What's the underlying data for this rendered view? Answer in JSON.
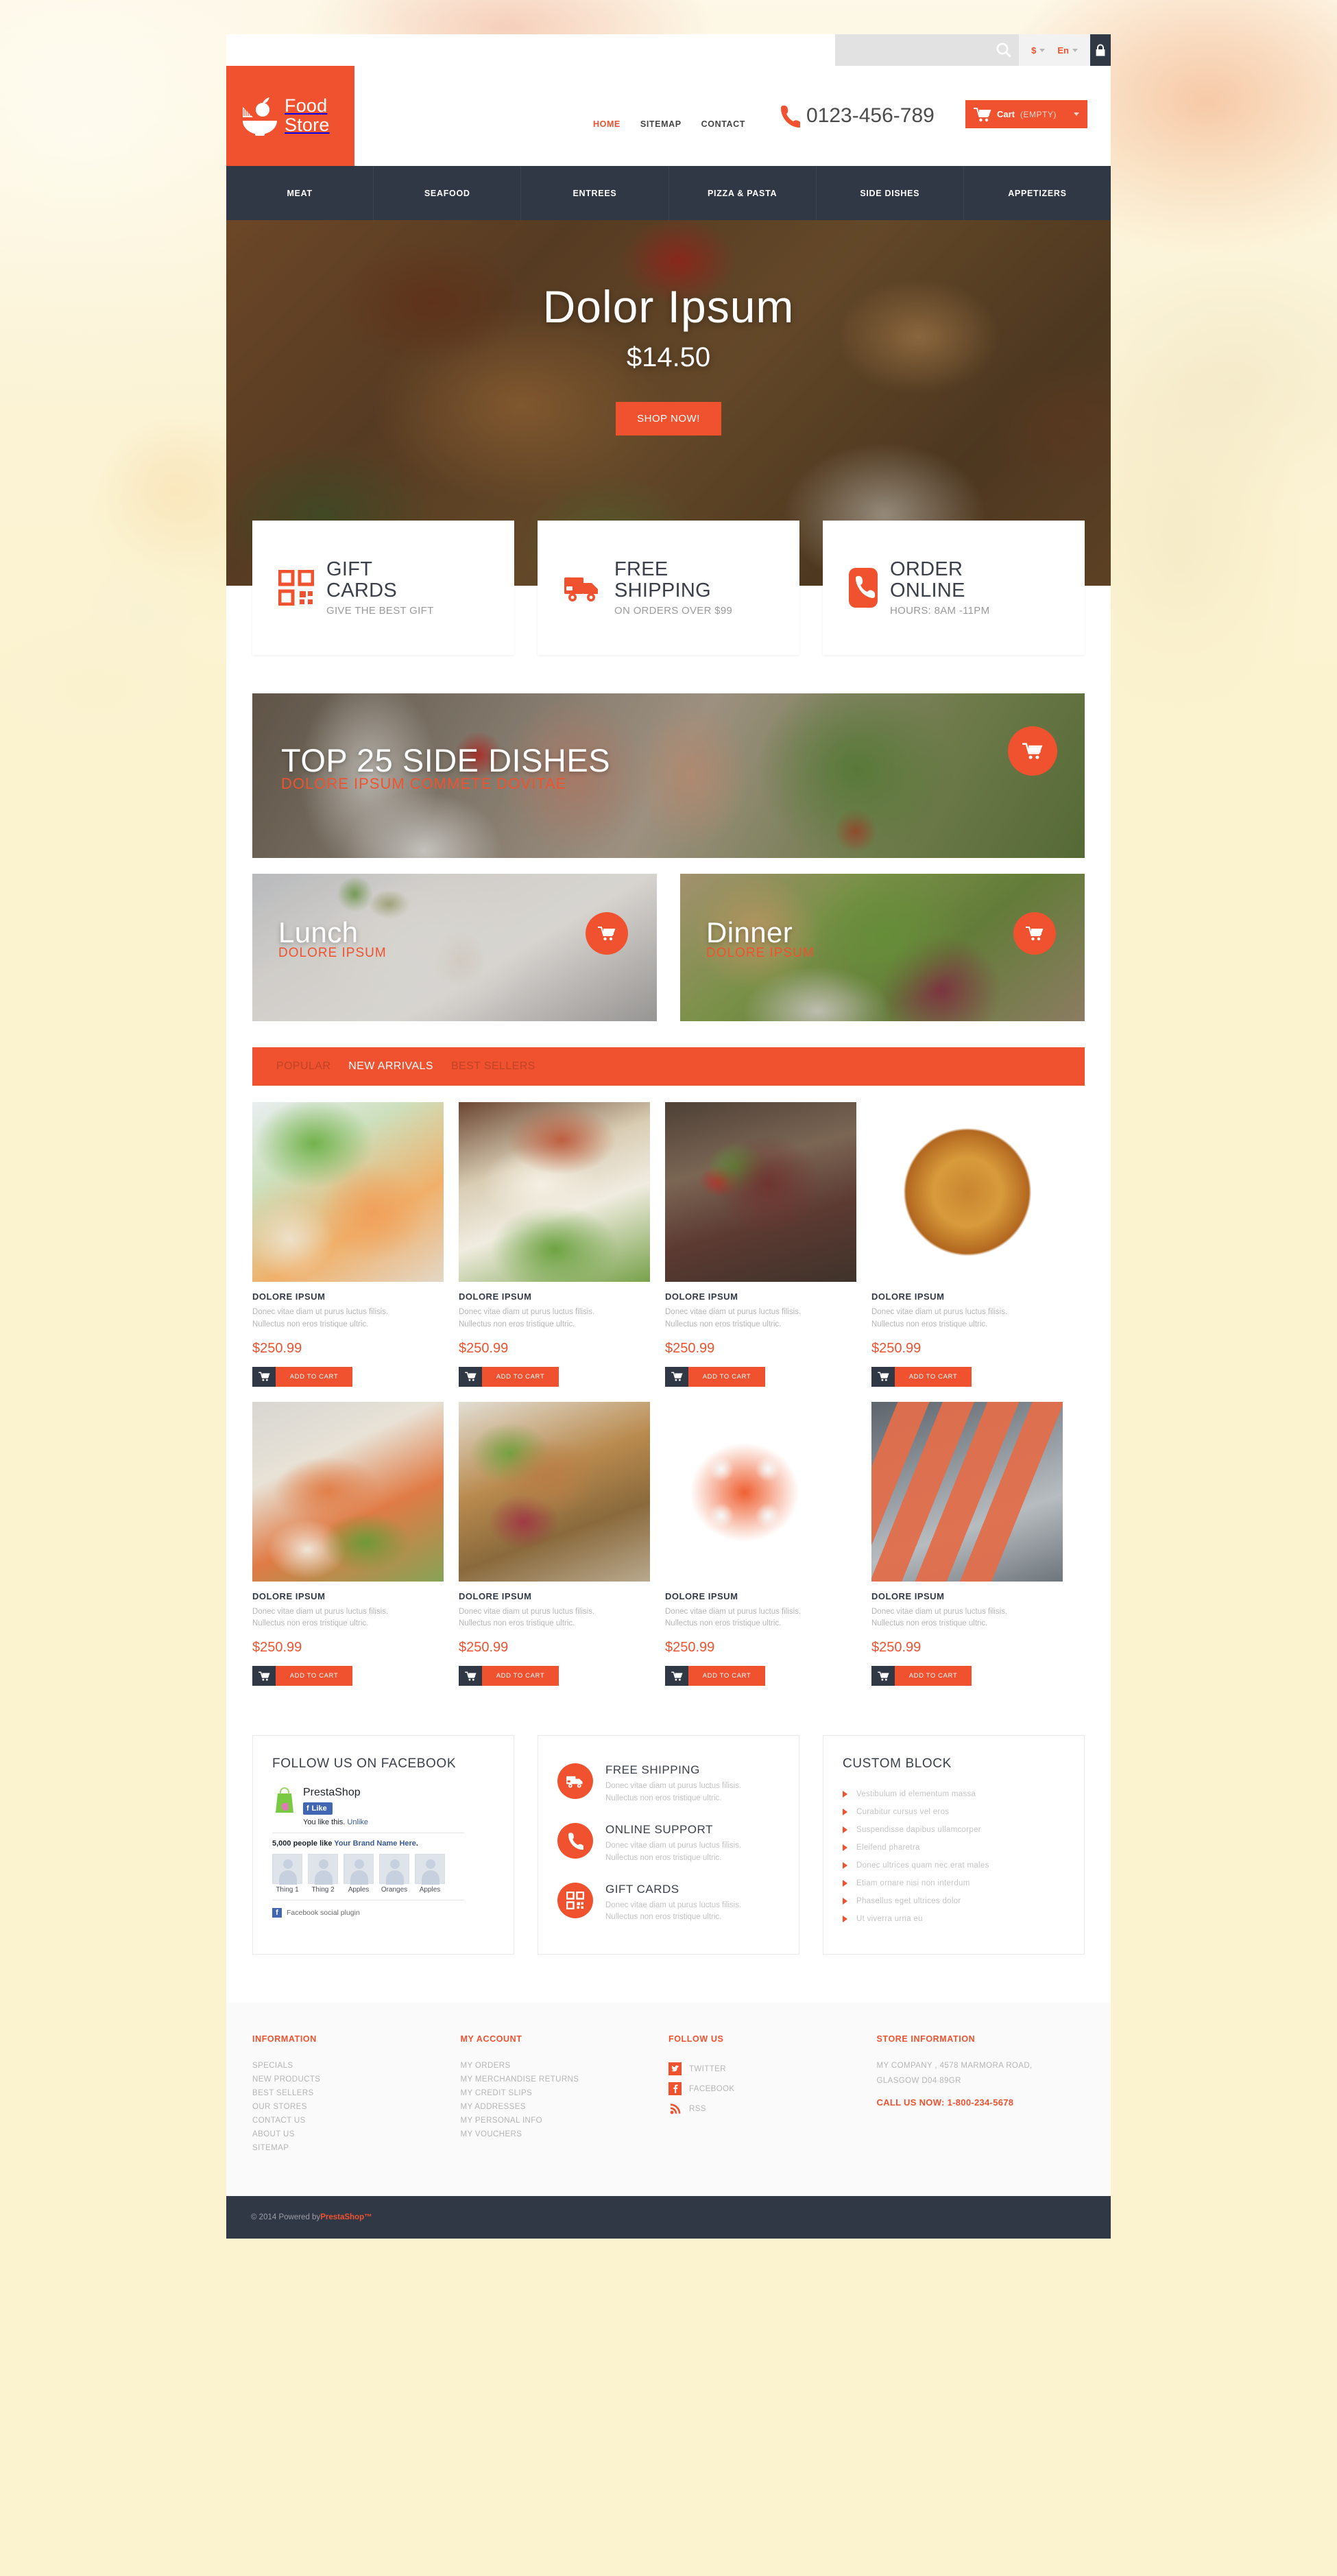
{
  "utility": {
    "search_placeholder": "",
    "search_value": "",
    "currency": "$",
    "language": "En"
  },
  "header": {
    "logo_line1": "Food",
    "logo_line2": "Store",
    "nav": [
      {
        "label": "HOME",
        "active": true
      },
      {
        "label": "SITEMAP",
        "active": false
      },
      {
        "label": "CONTACT",
        "active": false
      }
    ],
    "phone": "0123-456-789",
    "cart_label": "Cart",
    "cart_status": "(EMPTY)"
  },
  "mainnav": [
    "MEAT",
    "SEAFOOD",
    "ENTREES",
    "PIZZA & PASTA",
    "SIDE DISHES",
    "APPETIZERS"
  ],
  "hero": {
    "title": "Dolor Ipsum",
    "price": "$14.50",
    "cta": "SHOP NOW!",
    "slide_count": 3,
    "active_slide": 1
  },
  "features": [
    {
      "icon": "gift-card-icon",
      "title_line1": "GIFT",
      "title_line2": "CARDS",
      "subtitle": "GIVE THE BEST GIFT"
    },
    {
      "icon": "truck-icon",
      "title_line1": "FREE",
      "title_line2": "SHIPPING",
      "subtitle": "ON ORDERS OVER $99"
    },
    {
      "icon": "phone-icon",
      "title_line1": "ORDER",
      "title_line2": "ONLINE",
      "subtitle": "HOURS: 8AM -11PM"
    }
  ],
  "banners": {
    "wide": {
      "title": "TOP 25 SIDE DISHES",
      "subtitle": "DOLORE IPSUM COMMETE DOVITAE"
    },
    "half": [
      {
        "title": "Lunch",
        "subtitle": "DOLORE IPSUM"
      },
      {
        "title": "Dinner",
        "subtitle": "DOLORE IPSUM"
      }
    ]
  },
  "tabs": [
    {
      "label": "POPULAR",
      "active": false
    },
    {
      "label": "NEW ARRIVALS",
      "active": true
    },
    {
      "label": "BEST SELLERS",
      "active": false
    }
  ],
  "product_defaults": {
    "name": "DOLORE IPSUM",
    "desc_line1": "Donec vitae diam ut purus luctus filisis.",
    "desc_line2": "Nullectus non eros tristique ultric.",
    "price": "$250.99",
    "add_label": "ADD TO CART"
  },
  "products": [
    {
      "name": "DOLORE IPSUM",
      "desc_line1": "Donec vitae diam ut purus luctus filisis.",
      "desc_line2": "Nullectus non eros tristique ultric.",
      "price": "$250.99",
      "add_label": "ADD TO CART",
      "img": "salad-with-melon"
    },
    {
      "name": "DOLORE IPSUM",
      "desc_line1": "Donec vitae diam ut purus luctus filisis.",
      "desc_line2": "Nullectus non eros tristique ultric.",
      "price": "$250.99",
      "add_label": "ADD TO CART",
      "img": "fish-fillet-salad"
    },
    {
      "name": "DOLORE IPSUM",
      "desc_line1": "Donec vitae diam ut purus luctus filisis.",
      "desc_line2": "Nullectus non eros tristique ultric.",
      "price": "$250.99",
      "add_label": "ADD TO CART",
      "img": "grilled-steak"
    },
    {
      "name": "DOLORE IPSUM",
      "desc_line1": "Donec vitae diam ut purus luctus filisis.",
      "desc_line2": "Nullectus non eros tristique ultric.",
      "price": "$250.99",
      "add_label": "ADD TO CART",
      "img": "pizza"
    },
    {
      "name": "DOLORE IPSUM",
      "desc_line1": "Donec vitae diam ut purus luctus filisis.",
      "desc_line2": "Nullectus non eros tristique ultric.",
      "price": "$250.99",
      "add_label": "ADD TO CART",
      "img": "salmon-with-beans"
    },
    {
      "name": "DOLORE IPSUM",
      "desc_line1": "Donec vitae diam ut purus luctus filisis.",
      "desc_line2": "Nullectus non eros tristique ultric.",
      "price": "$250.99",
      "add_label": "ADD TO CART",
      "img": "roasted-meat-plate"
    },
    {
      "name": "DOLORE IPSUM",
      "desc_line1": "Donec vitae diam ut purus luctus filisis.",
      "desc_line2": "Nullectus non eros tristique ultric.",
      "price": "$250.99",
      "add_label": "ADD TO CART",
      "img": "sushi-rolls"
    },
    {
      "name": "DOLORE IPSUM",
      "desc_line1": "Donec vitae diam ut purus luctus filisis.",
      "desc_line2": "Nullectus non eros tristique ultric.",
      "price": "$250.99",
      "add_label": "ADD TO CART",
      "img": "salmon-slices"
    }
  ],
  "facebook_block": {
    "title": "FOLLOW US ON FACEBOOK",
    "page_name": "PrestaShop",
    "like_label": "Like",
    "you_like": "You like this.",
    "unlike": "Unlike",
    "count_prefix": "5,000 people like ",
    "brand": "Your Brand Name Here",
    "count_suffix": ".",
    "faces": [
      "Thing 1",
      "Thing 2",
      "Apples",
      "Oranges",
      "Apples"
    ],
    "plugin_label": "Facebook social plugin"
  },
  "services_block": [
    {
      "icon": "truck-icon",
      "title": "FREE SHIPPING",
      "desc_line1": "Donec vitae diam ut purus luctus filisis.",
      "desc_line2": "Nullectus non eros tristique ultric."
    },
    {
      "icon": "phone-icon",
      "title": "ONLINE SUPPORT",
      "desc_line1": "Donec vitae diam ut purus luctus filisis.",
      "desc_line2": "Nullectus non eros tristique ultric."
    },
    {
      "icon": "gift-card-icon",
      "title": "GIFT CARDS",
      "desc_line1": "Donec vitae diam ut purus luctus filisis.",
      "desc_line2": "Nullectus non eros tristique ultric."
    }
  ],
  "custom_block": {
    "title": "CUSTOM BLOCK",
    "items": [
      "Vestibulum id elementum massa",
      "Curabitur cursus vel eros",
      "Suspendisse dapibus ullamcorper",
      "Eleifend pharetra",
      "Donec ultrices quam nec erat males",
      "Etiam ornare nisi non interdum",
      "Phasellus eget ultrices dolor",
      "Ut viverra urna eu"
    ]
  },
  "footer": {
    "information": {
      "title": "INFORMATION",
      "links": [
        "SPECIALS",
        "NEW PRODUCTS",
        "BEST SELLERS",
        "OUR STORES",
        "CONTACT US",
        "ABOUT US",
        "SITEMAP"
      ]
    },
    "my_account": {
      "title": "MY ACCOUNT",
      "links": [
        "MY ORDERS",
        "MY MERCHANDISE RETURNS",
        "MY CREDIT SLIPS",
        "MY ADDRESSES",
        "MY PERSONAL INFO",
        "MY VOUCHERS"
      ]
    },
    "follow_us": {
      "title": "FOLLOW US",
      "links": [
        {
          "label": "TWITTER",
          "icon": "twitter-icon"
        },
        {
          "label": "FACEBOOK",
          "icon": "facebook-icon"
        },
        {
          "label": "RSS",
          "icon": "rss-icon"
        }
      ]
    },
    "store_information": {
      "title": "STORE INFORMATION",
      "address_line1": "MY COMPANY , 4578 MARMORA ROAD,",
      "address_line2": "GLASGOW D04 89GR",
      "call_label": "CALL US NOW:",
      "call_number": "1-800-234-5678"
    },
    "copyright_prefix": "© 2014 Powered by ",
    "copyright_brand": "PrestaShop™"
  },
  "colors": {
    "accent": "#f0522f",
    "dark": "#313845",
    "page_bg": "#fbf3d0"
  }
}
